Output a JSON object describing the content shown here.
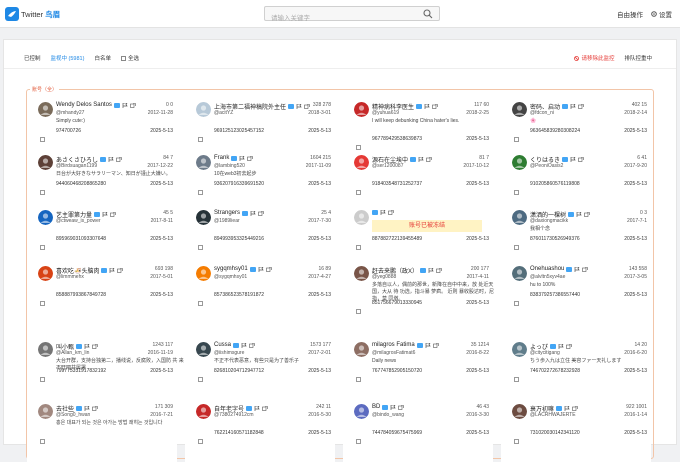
{
  "header": {
    "app_name": "Twitter",
    "app_name_cn": "鸟眉",
    "search_placeholder": "请输入关键字",
    "auto_label": "自由操作",
    "settings_label": "设置"
  },
  "tabs": [
    "已控制",
    "监视中 (5981)",
    "白名单"
  ],
  "select_all": "全选",
  "delete_label": "请移除此监控",
  "sort_label": "排队控重中",
  "group_label": "账号（全）",
  "colors": {
    "accent": "#1e88e5",
    "danger": "#e53935",
    "group_border": "#f2c5a8"
  },
  "accounts": [
    {
      "name": "Wendy Delos Santos",
      "handle": "@mhandy27",
      "counts": "0  0",
      "date": "2012-11-28",
      "desc": "Simply cute:)",
      "id": "974700726",
      "date2": "2025-5-13",
      "avatar": "#7a6b5a"
    },
    {
      "name": "上海市第二福神稿院外主任",
      "handle": "@acitYZ",
      "counts": "328  278",
      "date": "2018-3-01",
      "desc": "",
      "id": "969125123025457152",
      "date2": "2025-5-13",
      "avatar": "#b7c9d8"
    },
    {
      "name": "精神病科李医生",
      "handle": "@yuhua619",
      "counts": "117  60",
      "date": "2018-2-25",
      "desc": "I will keep debunking China hater's lies.",
      "id": "967789429538639873",
      "date2": "2025-5-13",
      "avatar": "#c62828"
    },
    {
      "name": "密码、启动",
      "handle": "@fdcon_ni",
      "counts": "402  15",
      "date": "2018-2-14",
      "desc": "🌸",
      "id": "963645839280308224",
      "date2": "2025-5-13",
      "avatar": "#444444"
    },
    {
      "name": "あさくさひろし",
      "handle": "@Birdsuagan1199",
      "counts": "84  7",
      "date": "2017-12-22",
      "desc": "日台が大好きなサラリーマン、知日が謹止大嫌い。",
      "id": "944060468208865280",
      "date2": "2025-5-13",
      "avatar": "#5d4037"
    },
    {
      "name": "Frank",
      "handle": "@lambing520",
      "counts": "1604  215",
      "date": "2017-11-09",
      "desc": "10在web3初去起步",
      "id": "936207916339691520",
      "date2": "2025-5-13",
      "avatar": "#6d7b8a"
    },
    {
      "name": "源石在尘埃中",
      "handle": "@ser1200087",
      "counts": "81  7",
      "date": "2017-10-12",
      "desc": "",
      "id": "918403548731252737",
      "date2": "2025-5-13",
      "avatar": "#e53935"
    },
    {
      "name": "くりはるき",
      "handle": "@PeoniOasis2",
      "counts": "6  41",
      "date": "2017-9-20",
      "desc": "",
      "id": "910205860576119808",
      "date2": "2025-5-13",
      "avatar": "#2e7d32"
    },
    {
      "name": "艺主罪第力量",
      "handle": "@ctweaw_is_power",
      "counts": "45  5",
      "date": "2017-8-11",
      "desc": "",
      "id": "895969031093307648",
      "date2": "2025-5-13",
      "avatar": "#1565c0"
    },
    {
      "name": "Strangers",
      "handle": "@1989liear",
      "counts": "25  4",
      "date": "2017-7-30",
      "desc": "",
      "id": "894993953325449216",
      "date2": "2025-5-13",
      "avatar": "#263238"
    },
    {
      "name": "",
      "handle": "",
      "counts": "",
      "date": "",
      "desc": "",
      "id": "887882722139455489",
      "date2": "2025-5-13",
      "avatar": "#cccccc",
      "frozen": "账号已被冻结"
    },
    {
      "name": "潇洒的一棵树",
      "handle": "@daxiongmacikk",
      "counts": "0  3",
      "date": "2017-7-1",
      "desc": "我相个念",
      "id": "876011730526949376",
      "date2": "2025-5-13",
      "avatar": "#4e6b82"
    },
    {
      "name": "喜欢吃🍜头脑肉",
      "handle": "@limmmehx",
      "counts": "693  198",
      "date": "2017-5-01",
      "desc": "",
      "id": "858887993867849728",
      "date2": "2025-5-13",
      "avatar": "#d84315"
    },
    {
      "name": "sygqmhsy01",
      "handle": "@sygqmhsy01",
      "counts": "16  89",
      "date": "2017-4-27",
      "desc": "",
      "id": "857386523578191872",
      "date2": "2025-5-13",
      "avatar": "#f57c00"
    },
    {
      "name": "赶去来鹏（政X）",
      "handle": "@yeg0888",
      "counts": "200  177",
      "date": "2017-4-11",
      "desc": "多落自以人，偶前的那世，新降在自中中来，放 处近天国，大从 待 功选，指斗暴 萝疯。 近则 暴收股达时，尼指，莫 同墩。",
      "id": "851756679013330945",
      "date2": "2025-5-13",
      "avatar": "#795548"
    },
    {
      "name": "Onehuashou",
      "handle": "@alvltn5xyv4ae",
      "counts": "143  558",
      "date": "2017-3-05",
      "desc": "hu to 100%",
      "id": "838379257386557440",
      "date2": "2025-5-13",
      "avatar": "#546e7a"
    },
    {
      "name": "叫小甄",
      "handle": "@Allan_km_lin",
      "counts": "1243  117",
      "date": "2016-11-19",
      "desc": "大台开群，支持台独第二，播线说，反腐败，入国防 共 来不旺吧共属署",
      "id": "799775331917832192",
      "date2": "2025-5-13",
      "avatar": "#757575"
    },
    {
      "name": "Cussa",
      "handle": "@iishimsgure",
      "counts": "1573  177",
      "date": "2017-2-01",
      "desc": "不正不代表恶意，有些只是为了善乐子",
      "id": "826810204712947712",
      "date2": "2025-5-13",
      "avatar": "#37474f"
    },
    {
      "name": "milagros Fatima",
      "handle": "@milagrosFatimat6",
      "counts": "35  1214",
      "date": "2016-8-22",
      "desc": "Daily news",
      "id": "767747852905150720",
      "date2": "2025-5-13",
      "avatar": "#8d6e63"
    },
    {
      "name": "よっぴ",
      "handle": "@citycitigang",
      "counts": "14  20",
      "date": "2016-6-20",
      "desc": "ちう歩入九は立住 美容ファー天礼します",
      "id": "746702272678232928",
      "date2": "2025-5-13",
      "avatar": "#607d8b"
    },
    {
      "name": "去社些",
      "handle": "@Song0_hwan",
      "counts": "171  309",
      "date": "2016-7-21",
      "desc": "홍은 대표가 되는 것은 아가는 방법 쾌히는 것입니다",
      "id": "",
      "date2": "",
      "avatar": "#a1887f"
    },
    {
      "name": "自年老字号",
      "handle": "@7380274912cm",
      "counts": "242  11",
      "date": "2016-5-30",
      "desc": "",
      "id": "762214160571182848",
      "date2": "2025-5-13",
      "avatar": "#c62828"
    },
    {
      "name": "BD",
      "handle": "@bindo_wang",
      "counts": "46  43",
      "date": "2016-3-30",
      "desc": "",
      "id": "744784059675475969",
      "date2": "2025-5-13",
      "avatar": "#5c6bc0"
    },
    {
      "name": "衰万初嘛",
      "handle": "@LACRHWAJERTE",
      "counts": "922  1001",
      "date": "2016-1-14",
      "desc": "",
      "id": "731020030142341120",
      "date2": "2025-5-13",
      "avatar": "#6d4c41"
    }
  ]
}
